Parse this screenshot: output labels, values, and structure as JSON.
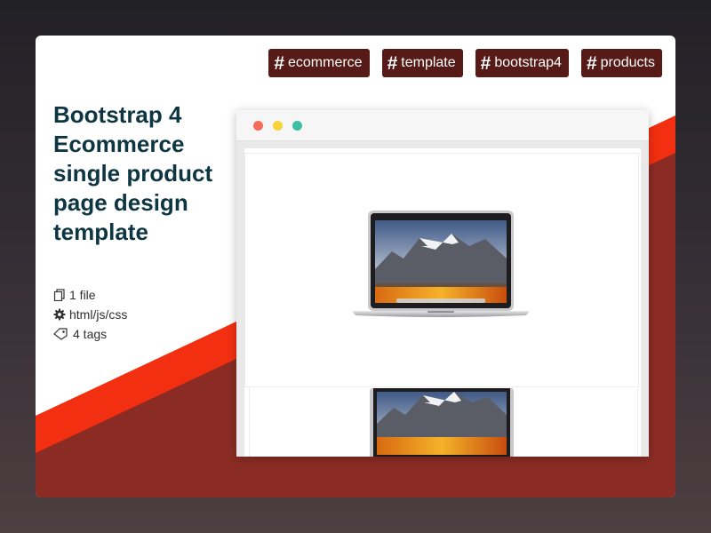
{
  "tags": [
    {
      "label": "ecommerce"
    },
    {
      "label": "template"
    },
    {
      "label": "bootstrap4"
    },
    {
      "label": "products"
    }
  ],
  "title": "Bootstrap 4 Ecommerce single product page design template",
  "meta": {
    "files": "1 file",
    "tech": "html/js/css",
    "tag_count": "4 tags"
  },
  "icons": {
    "files": "files-icon",
    "tech": "gear-icon",
    "tags": "tags-icon",
    "hash": "hash-icon"
  },
  "colors": {
    "tag_bg": "#561a17",
    "title": "#0d3642",
    "accent_red": "#f22f10",
    "accent_dark": "#8a2c24"
  }
}
